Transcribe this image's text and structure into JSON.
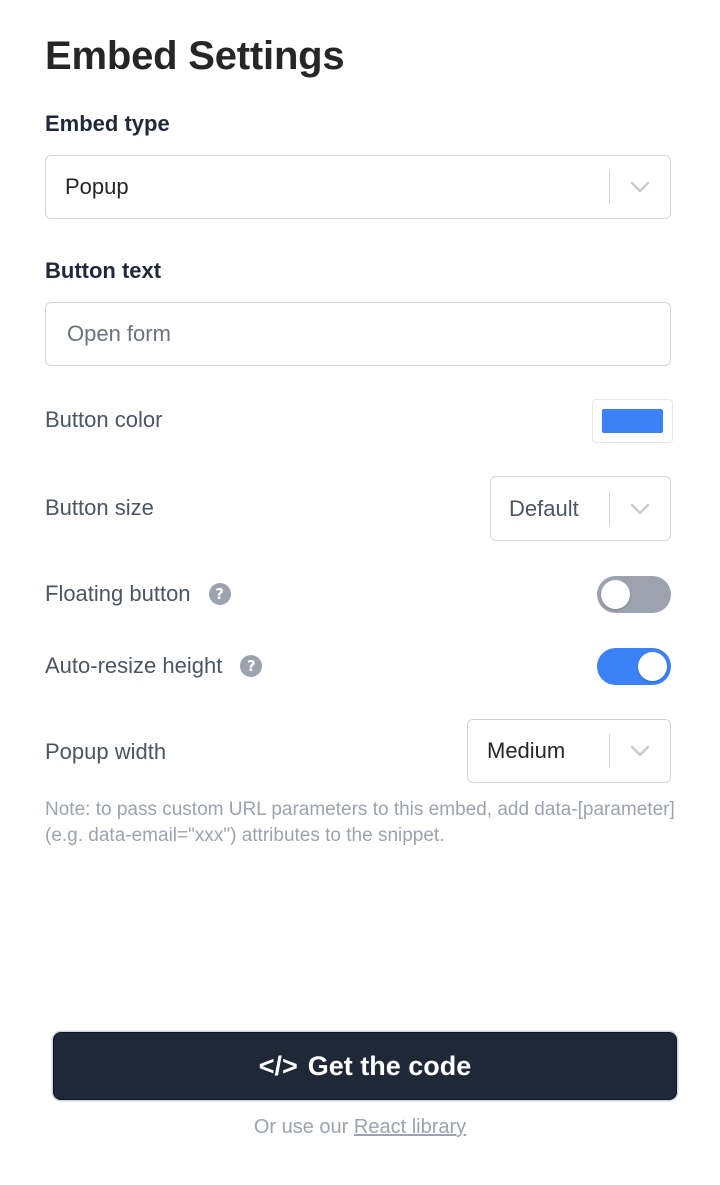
{
  "title": "Embed Settings",
  "embed_type": {
    "label": "Embed type",
    "value": "Popup"
  },
  "button_text": {
    "label": "Button text",
    "placeholder": "Open form"
  },
  "button_color": {
    "label": "Button color",
    "color": "#3b82f6"
  },
  "button_size": {
    "label": "Button size",
    "value": "Default"
  },
  "floating_button": {
    "label": "Floating button",
    "enabled": false,
    "help_icon": "question-circle-icon"
  },
  "auto_resize_height": {
    "label": "Auto-resize height",
    "enabled": true,
    "help_icon": "question-circle-icon"
  },
  "popup_width": {
    "label": "Popup width",
    "value": "Medium"
  },
  "note": "Note: to pass custom URL parameters to this embed, add data-[parameter] (e.g. data-email=\"xxx\") attributes to the snippet.",
  "cta": {
    "icon": "code-icon",
    "icon_glyph": "</>",
    "label": "Get the code"
  },
  "footer": {
    "prefix": "Or use our",
    "link_label": "React library"
  },
  "colors": {
    "toggle_on": "#3b82f6",
    "toggle_off": "#9ca3af",
    "cta_background": "#1e2837"
  }
}
